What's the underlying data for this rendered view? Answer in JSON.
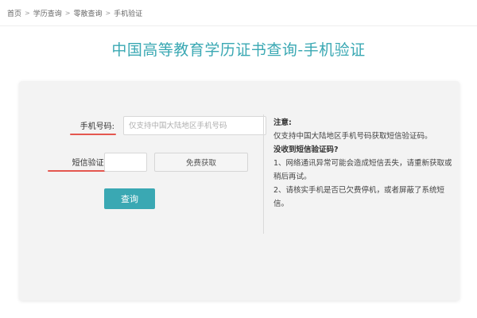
{
  "breadcrumb": {
    "items": [
      "首页",
      "学历查询",
      "零散查询",
      "手机验证"
    ],
    "separator": ">"
  },
  "page": {
    "title": "中国高等教育学历证书查询-手机验证",
    "accent_color": "#3aa8b3",
    "underline_color": "#e4574f"
  },
  "form": {
    "phone_label": "手机号码:",
    "phone_placeholder": "仅支持中国大陆地区手机号码",
    "phone_value": "",
    "sms_label": "短信验证码:",
    "sms_value": "",
    "sms_button_label": "免费获取",
    "submit_label": "查询"
  },
  "notes": {
    "heading": "注意:",
    "line1": "仅支持中国大陆地区手机号码获取短信验证码。",
    "heading2": "没收到短信验证码?",
    "item1": "1、网络通讯异常可能会造成短信丢失，请重新获取或稍后再试。",
    "item2": "2、请核实手机是否已欠费停机，或者屏蔽了系统短信。"
  }
}
